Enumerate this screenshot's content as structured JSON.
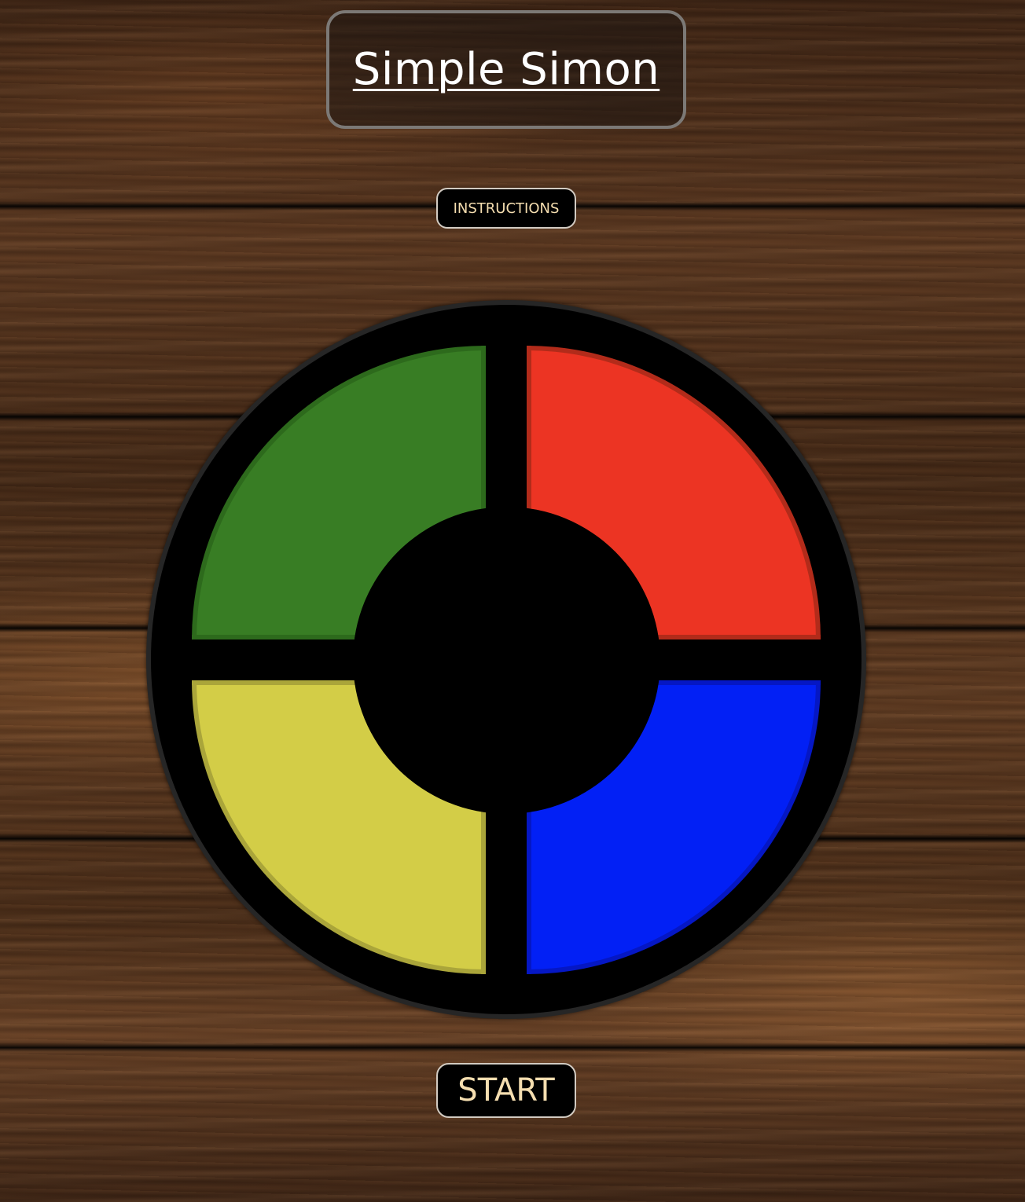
{
  "game": {
    "title": "Simple Simon",
    "instructions_label": "INSTRUCTIONS",
    "start_label": "START"
  },
  "pads": [
    {
      "color_name": "green",
      "color": "#387d24"
    },
    {
      "color_name": "red",
      "color": "#ec3423"
    },
    {
      "color_name": "yellow",
      "color": "#d3cd47"
    },
    {
      "color_name": "blue",
      "color": "#0220f5"
    }
  ],
  "theme": {
    "background": "wood",
    "button_background": "#000000",
    "button_text_color": "#f5deb0",
    "title_color": "#ffffff"
  }
}
